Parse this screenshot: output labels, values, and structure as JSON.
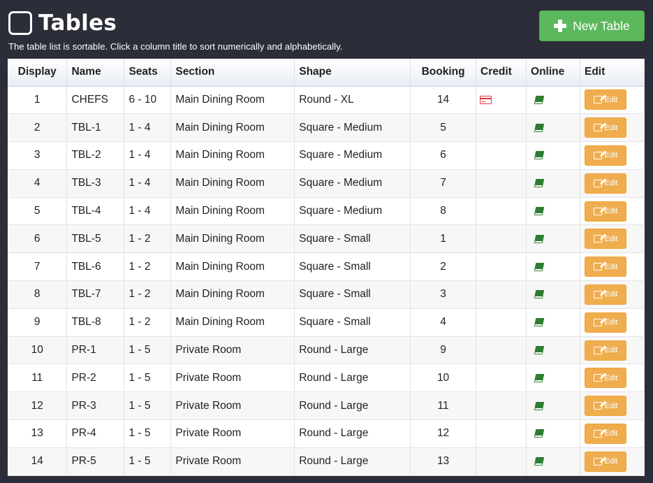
{
  "header": {
    "title": "Tables",
    "title_icon": "square-outline-icon",
    "subtitle": "The table list is sortable. Click a column title to sort numerically and alphabetically.",
    "new_button_label": "New Table",
    "new_button_icon": "plus-icon"
  },
  "colors": {
    "background": "#2b2d38",
    "new_button": "#5cb85c",
    "edit_button": "#f0ad4e",
    "credit_icon": "#d9343a",
    "online_icon": "#2e7d32"
  },
  "table": {
    "columns": [
      "Display",
      "Name",
      "Seats",
      "Section",
      "Shape",
      "Booking",
      "Credit",
      "Online",
      "Edit"
    ],
    "edit_label": "Edit",
    "rows": [
      {
        "display": "1",
        "name": "CHEFS",
        "seats": "6 - 10",
        "section": "Main Dining Room",
        "shape": "Round - XL",
        "booking": "14",
        "credit": true,
        "online": true
      },
      {
        "display": "2",
        "name": "TBL-1",
        "seats": "1 - 4",
        "section": "Main Dining Room",
        "shape": "Square - Medium",
        "booking": "5",
        "credit": false,
        "online": true
      },
      {
        "display": "3",
        "name": "TBL-2",
        "seats": "1 - 4",
        "section": "Main Dining Room",
        "shape": "Square - Medium",
        "booking": "6",
        "credit": false,
        "online": true
      },
      {
        "display": "4",
        "name": "TBL-3",
        "seats": "1 - 4",
        "section": "Main Dining Room",
        "shape": "Square - Medium",
        "booking": "7",
        "credit": false,
        "online": true
      },
      {
        "display": "5",
        "name": "TBL-4",
        "seats": "1 - 4",
        "section": "Main Dining Room",
        "shape": "Square - Medium",
        "booking": "8",
        "credit": false,
        "online": true
      },
      {
        "display": "6",
        "name": "TBL-5",
        "seats": "1 - 2",
        "section": "Main Dining Room",
        "shape": "Square - Small",
        "booking": "1",
        "credit": false,
        "online": true
      },
      {
        "display": "7",
        "name": "TBL-6",
        "seats": "1 - 2",
        "section": "Main Dining Room",
        "shape": "Square - Small",
        "booking": "2",
        "credit": false,
        "online": true
      },
      {
        "display": "8",
        "name": "TBL-7",
        "seats": "1 - 2",
        "section": "Main Dining Room",
        "shape": "Square - Small",
        "booking": "3",
        "credit": false,
        "online": true
      },
      {
        "display": "9",
        "name": "TBL-8",
        "seats": "1 - 2",
        "section": "Main Dining Room",
        "shape": "Square - Small",
        "booking": "4",
        "credit": false,
        "online": true
      },
      {
        "display": "10",
        "name": "PR-1",
        "seats": "1 - 5",
        "section": "Private Room",
        "shape": "Round - Large",
        "booking": "9",
        "credit": false,
        "online": true
      },
      {
        "display": "11",
        "name": "PR-2",
        "seats": "1 - 5",
        "section": "Private Room",
        "shape": "Round - Large",
        "booking": "10",
        "credit": false,
        "online": true
      },
      {
        "display": "12",
        "name": "PR-3",
        "seats": "1 - 5",
        "section": "Private Room",
        "shape": "Round - Large",
        "booking": "11",
        "credit": false,
        "online": true
      },
      {
        "display": "13",
        "name": "PR-4",
        "seats": "1 - 5",
        "section": "Private Room",
        "shape": "Round - Large",
        "booking": "12",
        "credit": false,
        "online": true
      },
      {
        "display": "14",
        "name": "PR-5",
        "seats": "1 - 5",
        "section": "Private Room",
        "shape": "Round - Large",
        "booking": "13",
        "credit": false,
        "online": true
      }
    ]
  }
}
